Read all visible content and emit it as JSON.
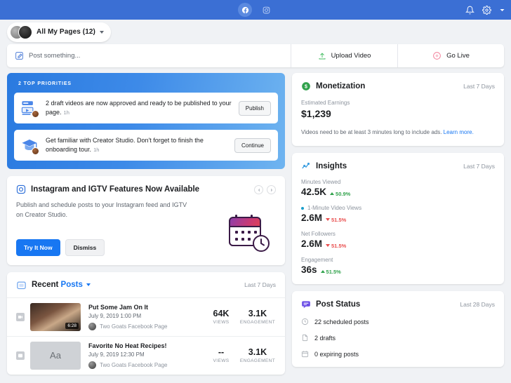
{
  "topbar": {
    "channels": [
      {
        "name": "facebook-channel",
        "icon": "facebook-icon",
        "active": true
      },
      {
        "name": "instagram-channel",
        "icon": "instagram-icon",
        "active": false
      }
    ],
    "notifications_icon": "bell-icon",
    "settings_icon": "gear-icon",
    "account_menu_icon": "chevron-down-icon",
    "bg_color": "#3b6fd4"
  },
  "page_selector": {
    "label": "All My Pages (12)"
  },
  "composer": {
    "placeholder": "Post something...",
    "upload_video_label": "Upload Video",
    "go_live_label": "Go Live"
  },
  "priorities": {
    "title": "2 TOP PRIORITIES",
    "items": [
      {
        "text": "2 draft videos are now approved and ready to be published to your page.",
        "time": "1h",
        "button": "Publish",
        "icon": "video-draft-icon"
      },
      {
        "text": "Get familiar with Creator Studio. Don't forget to finish the onboarding tour.",
        "time": "1h",
        "button": "Continue",
        "icon": "graduation-cap-icon"
      }
    ]
  },
  "igtv_promo": {
    "title": "Instagram and IGTV Features Now Available",
    "body": "Publish and schedule posts to your Instagram feed and IGTV on Creator Studio.",
    "primary_button": "Try It Now",
    "secondary_button": "Dismiss",
    "illustration": "calendar-clock-illustration"
  },
  "recent_posts": {
    "title_prefix": "Recent ",
    "title_accent": "Posts",
    "range": "Last 7 Days",
    "rows": [
      {
        "title": "Put Some Jam On It",
        "date": "July 9, 2019 1:00 PM",
        "page": "Two Goats Facebook Page",
        "duration": "6:28",
        "media_type": "video",
        "thumb_text": "",
        "views_value": "64K",
        "views_label": "VIEWS",
        "engagement_value": "3.1K",
        "engagement_label": "ENGAGEMENT"
      },
      {
        "title": "Favorite No Heat Recipes!",
        "date": "July 9, 2019 12:30 PM",
        "page": "Two Goats Facebook Page",
        "duration": "",
        "media_type": "text",
        "thumb_text": "Aa",
        "views_value": "--",
        "views_label": "VIEWS",
        "engagement_value": "3.1K",
        "engagement_label": "ENGAGEMENT"
      }
    ]
  },
  "monetization": {
    "title": "Monetization",
    "range": "Last 7 Days",
    "earnings_label": "Estimated Earnings",
    "earnings_value": "$1,239",
    "note": "Videos need to be at least 3 minutes long to include ads. ",
    "note_link": "Learn more.",
    "accent_color": "#31a24c"
  },
  "insights": {
    "title": "Insights",
    "range": "Last 7 Days",
    "metrics": [
      {
        "label": "Minutes Viewed",
        "value": "42.5K",
        "delta": "50.9%",
        "direction": "up",
        "dot": false
      },
      {
        "label": "1-Minute Video Views",
        "value": "2.6M",
        "delta": "51.5%",
        "direction": "down",
        "dot": true
      },
      {
        "label": "Net Followers",
        "value": "2.6M",
        "delta": "51.5%",
        "direction": "down",
        "dot": false
      },
      {
        "label": "Engagement",
        "value": "36s",
        "delta": "51.5%",
        "direction": "up",
        "dot": false
      }
    ]
  },
  "post_status": {
    "title": "Post Status",
    "range": "Last 28 Days",
    "items": [
      {
        "text": "22 scheduled posts",
        "icon": "clock-icon"
      },
      {
        "text": "2 drafts",
        "icon": "document-icon"
      },
      {
        "text": "0 expiring posts",
        "icon": "calendar-icon"
      }
    ]
  }
}
